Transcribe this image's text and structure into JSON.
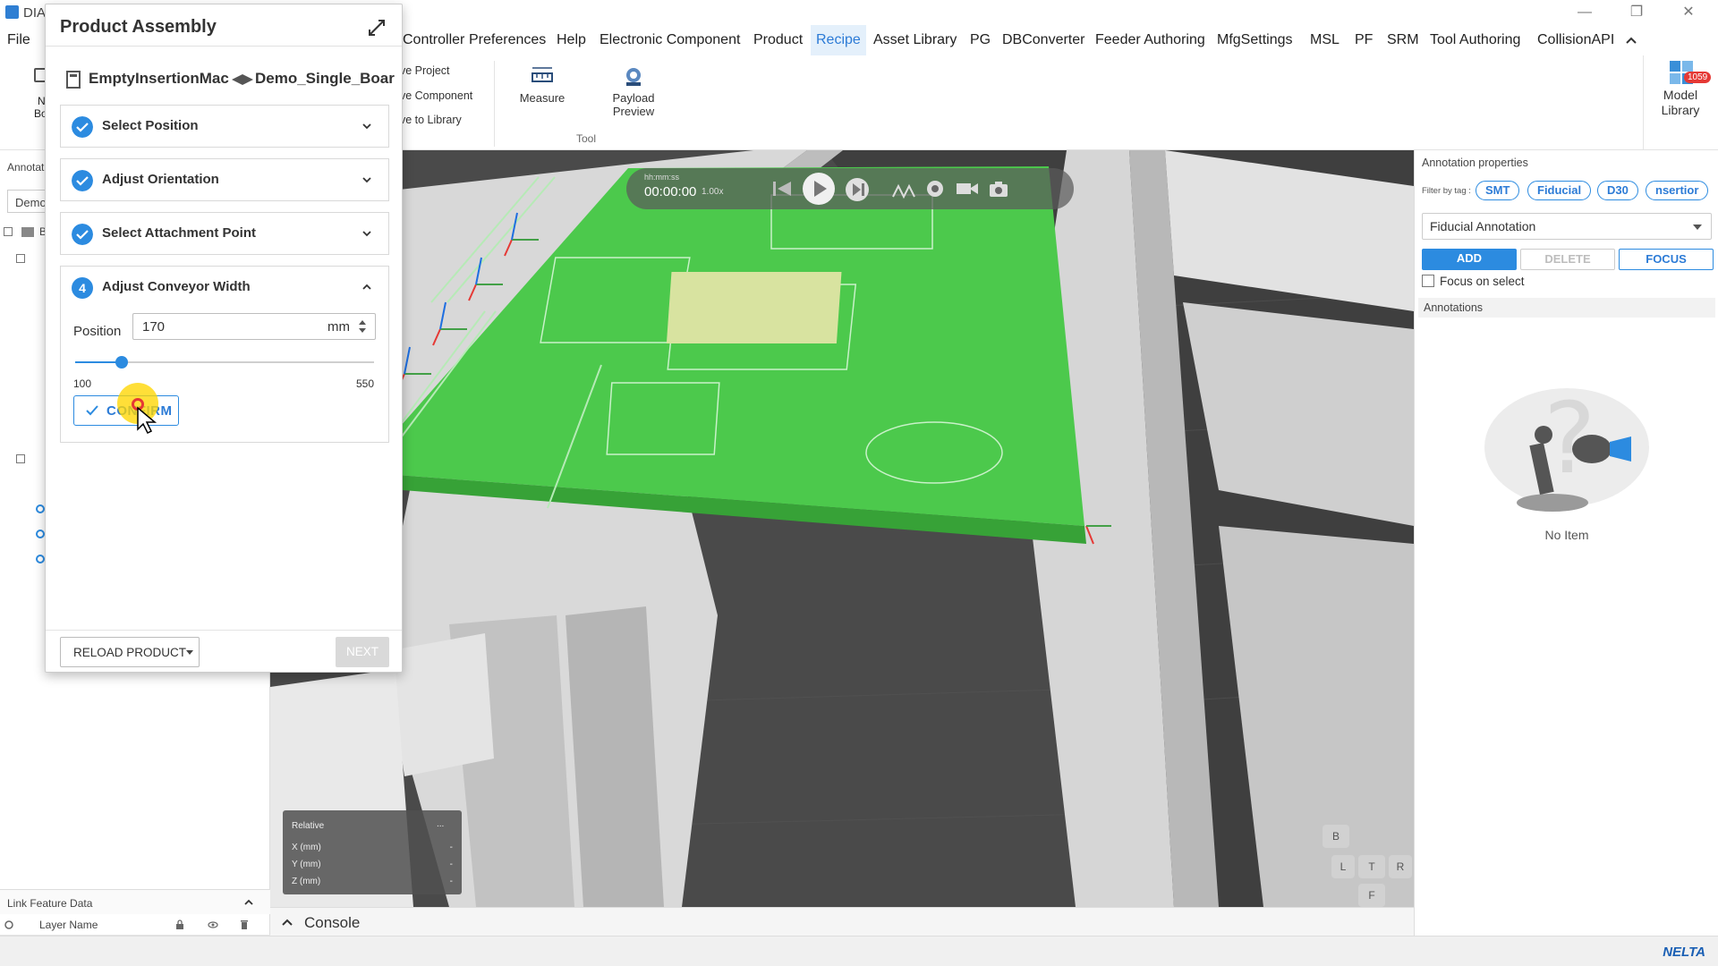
{
  "app": {
    "title": "DIA"
  },
  "menu": {
    "items": [
      "File",
      "Controller",
      "Preferences",
      "Help",
      "Electronic Component",
      "Product",
      "Recipe",
      "Asset Library",
      "PG",
      "DBConverter",
      "Feeder Authoring",
      "MfgSettings",
      "MSL",
      "PF",
      "SRM",
      "Tool Authoring",
      "CollisionAPI"
    ],
    "active": "Recipe"
  },
  "ribbon": {
    "save_project": "ave Project",
    "save_component": "ave Component",
    "save_to_library": "ave to Library",
    "measure": "Measure",
    "payload_preview_1": "Payload",
    "payload_preview_2": "Preview",
    "tool_group": "Tool",
    "model_library_1": "Model",
    "model_library_2": "Library",
    "model_library_badge": "1059",
    "left_button_1": "N",
    "left_button_2": "Bo"
  },
  "left_panel": {
    "annotation_tab": "Annotat",
    "combo_value": "Demo",
    "tree_root": "B",
    "link_feature_title": "Link Feature Data",
    "layer_name_col": "Layer Name"
  },
  "product_assembly": {
    "title": "Product Assembly",
    "machine": "EmptyInsertionMac",
    "board": "Demo_Single_Boar",
    "steps": [
      {
        "label": "Select Position",
        "state": "done"
      },
      {
        "label": "Adjust Orientation",
        "state": "done"
      },
      {
        "label": "Select Attachment Point",
        "state": "done"
      },
      {
        "label": "Adjust  Conveyor Width",
        "state": "active",
        "number": "4"
      }
    ],
    "position_label": "Position",
    "position_value": "170",
    "unit": "mm",
    "slider_min": "100",
    "slider_max": "550",
    "slider_min_value": 100,
    "slider_max_value": 550,
    "slider_value": 170,
    "confirm_label": "CONFIRM",
    "reload_label": "RELOAD PRODUCT",
    "next_label": "NEXT"
  },
  "viewport": {
    "time_format": "hh:mm:ss",
    "time": "00:00:00",
    "speed": "1.00x",
    "coords_title": "Relative",
    "coords_more": "...",
    "coords": [
      {
        "axis": "X (mm)",
        "value": "-"
      },
      {
        "axis": "Y (mm)",
        "value": "-"
      },
      {
        "axis": "Z (mm)",
        "value": "-"
      }
    ],
    "view_cube": {
      "back": "B",
      "left": "L",
      "top": "T",
      "right": "R",
      "front": "F"
    },
    "console_label": "Console"
  },
  "annotation_properties": {
    "title": "Annotation properties",
    "filter_label": "Filter by tag :",
    "tags": [
      "SMT",
      "Fiducial",
      "D30",
      "nsertior"
    ],
    "type_select": "Fiducial Annotation",
    "add_label": "ADD",
    "delete_label": "DELETE",
    "focus_label": "FOCUS",
    "focus_on_select_label": "Focus on select",
    "annotations_header": "Annotations",
    "empty_text": "No Item"
  },
  "brand": {
    "logo_text": "NELTA"
  },
  "colors": {
    "accent": "#2c8be0",
    "pcb": "#4cc94c",
    "viewport_bg": "#5a5a5a"
  }
}
